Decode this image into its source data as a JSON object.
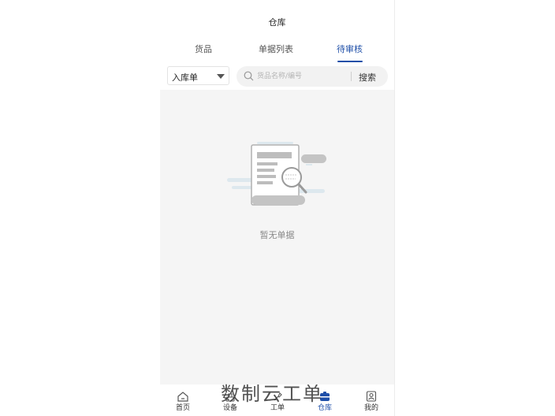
{
  "header": {
    "title": "仓库"
  },
  "tabs": [
    {
      "label": "货品",
      "active": false
    },
    {
      "label": "单据列表",
      "active": false
    },
    {
      "label": "待审核",
      "active": true
    }
  ],
  "filter": {
    "doc_type": "入库单",
    "search_placeholder": "货品名称/编号",
    "search_button": "搜索"
  },
  "empty_state": {
    "text": "暂无单据"
  },
  "tabbar": {
    "items": [
      {
        "label": "首页",
        "icon": "home-icon"
      },
      {
        "label": "设备",
        "icon": "device-icon"
      },
      {
        "label": "工单",
        "icon": "work-order-icon"
      },
      {
        "label": "仓库",
        "icon": "warehouse-icon",
        "active": true
      },
      {
        "label": "我的",
        "icon": "profile-icon"
      }
    ]
  },
  "watermark": "数制云工单",
  "colors": {
    "accent": "#1f4fa8",
    "content_bg": "#f5f5f5",
    "muted_text": "#888888"
  }
}
